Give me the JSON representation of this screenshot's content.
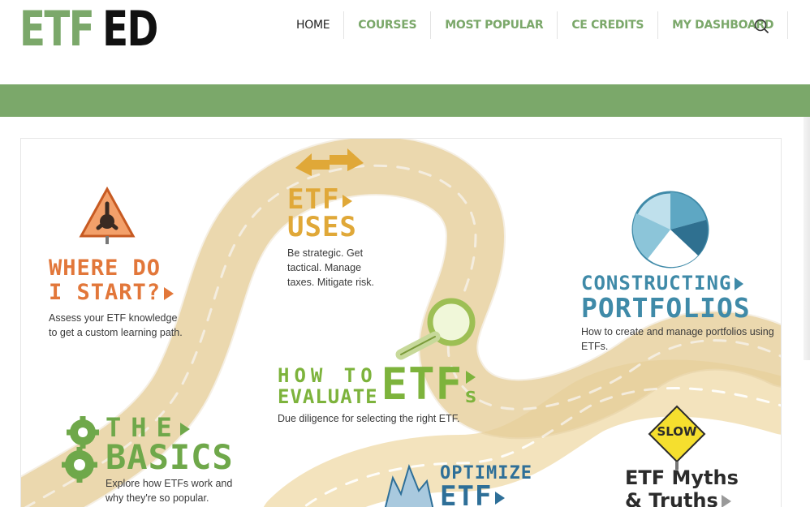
{
  "logo": {
    "part1": "ETF",
    "part2": "ED"
  },
  "nav": {
    "items": [
      {
        "label": "HOME"
      },
      {
        "label": "COURSES"
      },
      {
        "label": "MOST POPULAR"
      },
      {
        "label": "CE CREDITS"
      },
      {
        "label": "MY DASHBOARD"
      }
    ]
  },
  "sections": {
    "where": {
      "line1": "WHERE DO",
      "line2": "I START?",
      "desc": "Assess your ETF knowledge to get a custom learning path."
    },
    "uses": {
      "line1": "ETF",
      "line2": "USES",
      "desc": "Be strategic. Get tactical. Manage taxes. Mitigate risk."
    },
    "portfolios": {
      "line1": "CONSTRUCTING",
      "line2": "PORTFOLIOS",
      "desc": "How to create and manage portfolios using ETFs."
    },
    "evaluate": {
      "line1": "HOW TO",
      "line2": "EVALUATE",
      "big": "ETF",
      "s": "s",
      "desc": "Due diligence for selecting the right ETF."
    },
    "basics": {
      "line1": "THE",
      "line2": "BASICS",
      "desc": "Explore how ETFs work and why they're so popular."
    },
    "optimize": {
      "line1": "OPTIMIZE",
      "line2": "ETF"
    },
    "myths": {
      "sign": "SLOW",
      "line1": "ETF Myths",
      "line2": "& Truths"
    }
  },
  "colors": {
    "brand_green": "#7ba86a",
    "orange": "#e2773a",
    "gold": "#e0a838",
    "teal": "#3f8aa8",
    "lime": "#7db33c",
    "dark": "#2b2b2b"
  }
}
